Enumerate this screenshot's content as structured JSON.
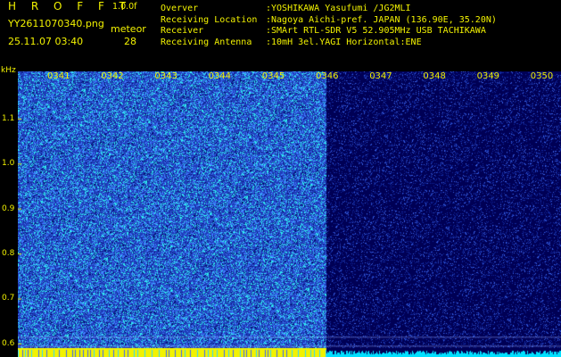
{
  "header": {
    "title": "H R O F F T",
    "version": "1.0.0f",
    "file_name": "YY2611070340.png",
    "meteor_label": "meteor",
    "datetime": "25.11.07 03:40",
    "meteor_count": "28"
  },
  "station_info": [
    {
      "key": "Overver",
      "value": ":YOSHIKAWA Yasufumi /JG2MLI"
    },
    {
      "key": "Receiving Location",
      "value": ":Nagoya Aichi-pref. JAPAN (136.90E, 35.20N)"
    },
    {
      "key": "Receiver",
      "value": ":SMArt RTL-SDR V5 52.905MHz USB TACHIKAWA"
    },
    {
      "key": "Receiving Antenna",
      "value": ":10mH 3el.YAGI Horizontal:ENE"
    }
  ],
  "axis": {
    "unit": "kHz",
    "ticks": [
      "1.1",
      "1.0",
      "0.9",
      "0.8",
      "0.7",
      "0.6"
    ],
    "tick_values": [
      1.1,
      1.0,
      0.9,
      0.8,
      0.7,
      0.6
    ],
    "range": [
      0.57,
      1.205
    ]
  },
  "time_labels": [
    "0341",
    "0342",
    "0343",
    "0344",
    "0345",
    "0346",
    "0347",
    "0348",
    "0349",
    "0350"
  ],
  "spectrogram": {
    "active_minutes": 6,
    "total_minutes": 10,
    "colors": {
      "active_bg": "#1e3db8",
      "inactive_bg": "#000055",
      "speckle_hi": "#2ff0f0",
      "speckle_mid": "#3f7cff",
      "baseline_active": "#f2f200",
      "baseline_inactive": "#00e0ff"
    }
  }
}
